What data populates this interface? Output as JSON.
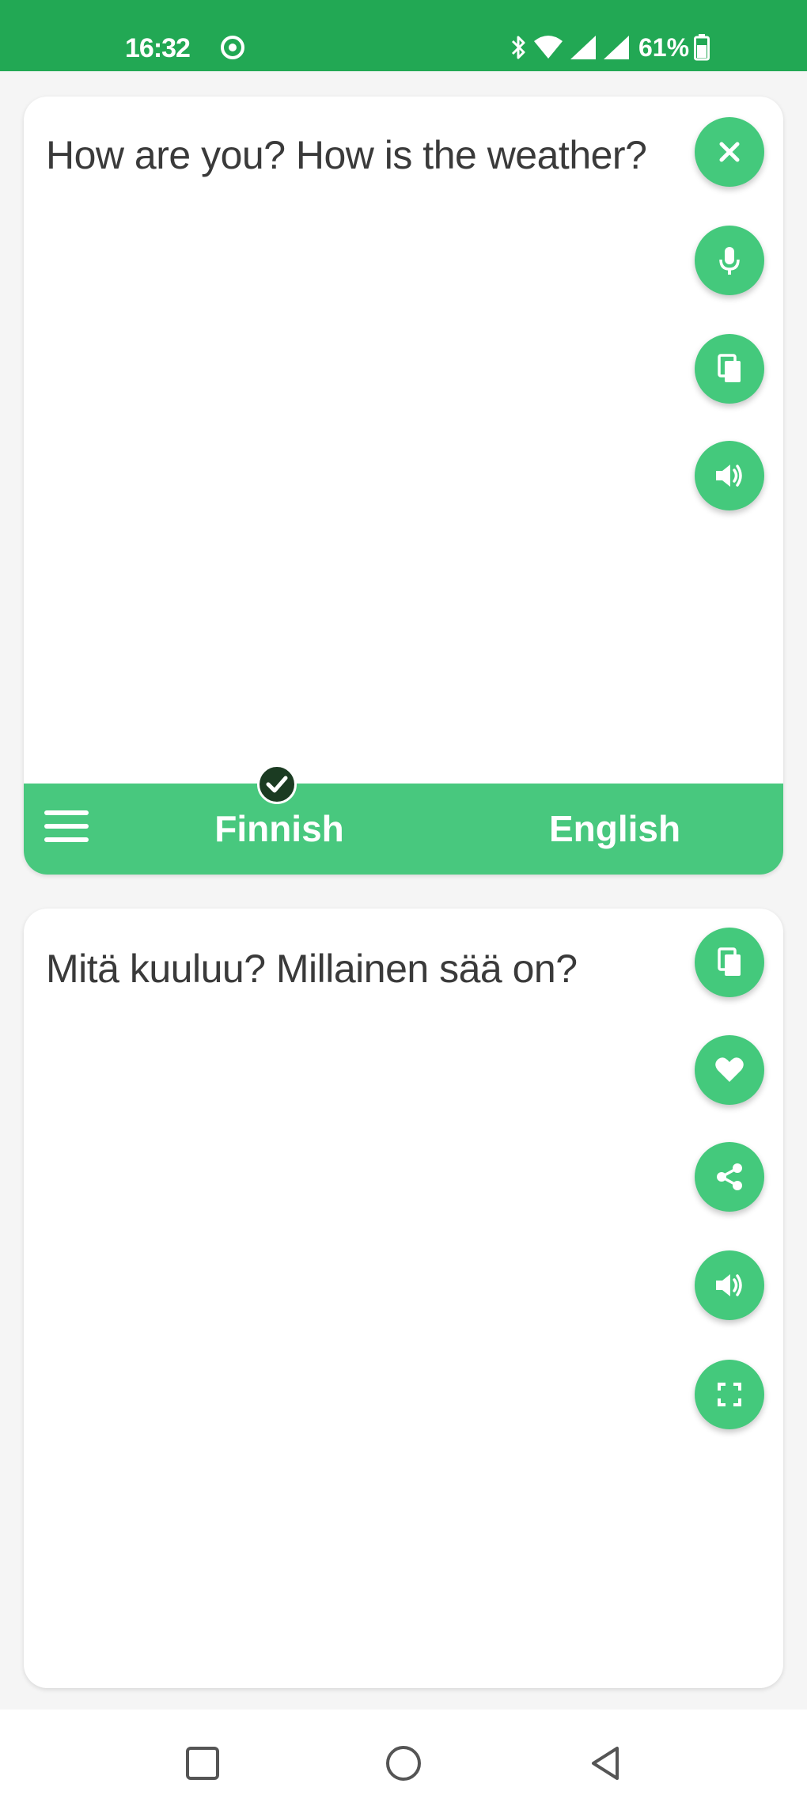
{
  "status_bar": {
    "time": "16:32",
    "battery": "61%",
    "icons": [
      "settings-status-icon",
      "bluetooth-icon",
      "wifi-icon",
      "signal-icon",
      "signal-icon-2",
      "battery-icon"
    ]
  },
  "source": {
    "text": "How are you? How is the weather?",
    "actions": [
      "close-icon",
      "microphone-icon",
      "paste-icon",
      "speaker-icon"
    ]
  },
  "language_bar": {
    "menu_icon": "menu-icon",
    "source_language": "Finnish",
    "target_language": "English",
    "selected_indicator": "check-icon"
  },
  "target": {
    "text": "Mitä kuuluu? Millainen sää on?",
    "actions": [
      "copy-icon",
      "favorite-icon",
      "share-icon",
      "speaker-icon",
      "fullscreen-icon"
    ]
  },
  "navigation": [
    "recents-icon",
    "home-icon",
    "back-icon"
  ],
  "colors": {
    "status_bar": "#22A854",
    "accent": "#44C97C",
    "language_bar": "#48C87E",
    "background": "#F5F5F5",
    "text": "#3A3A3A"
  }
}
